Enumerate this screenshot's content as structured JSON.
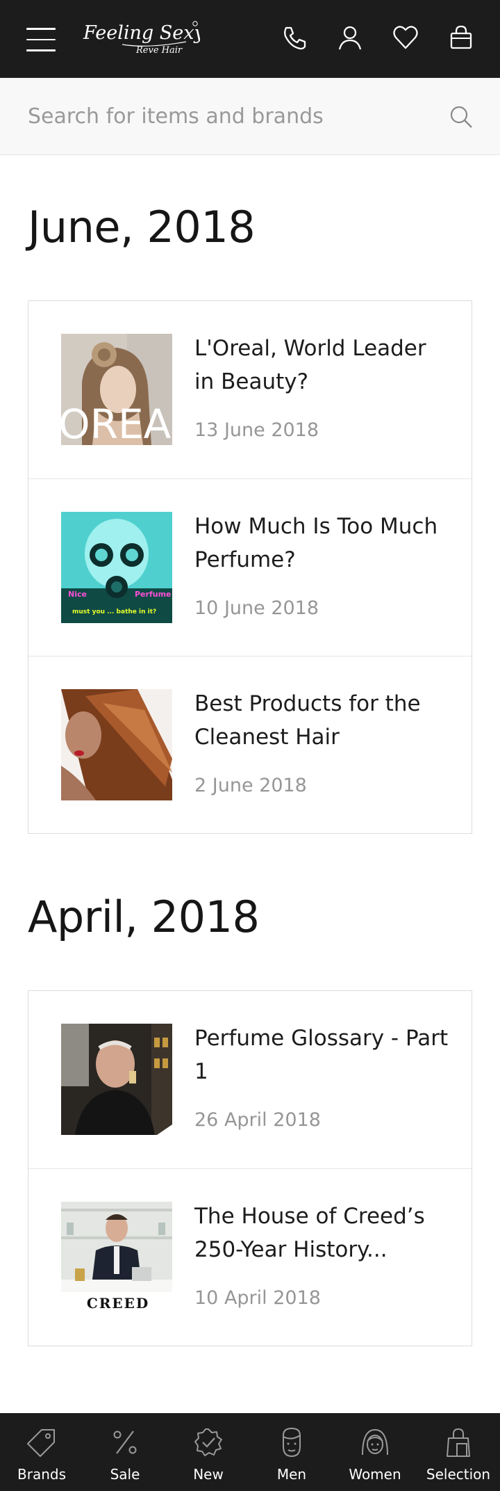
{
  "header": {
    "logo_text": "Feeling Sexy",
    "logo_subtext": "Reve Hair",
    "icons": [
      "menu-icon",
      "phone-icon",
      "user-icon",
      "heart-icon",
      "bag-icon"
    ]
  },
  "search": {
    "placeholder": "Search for items and brands",
    "value": ""
  },
  "sections": [
    {
      "month": "June, 2018",
      "articles": [
        {
          "title": "L'Oreal, World Leader in Beauty?",
          "date": "13 June 2018",
          "image_text": "OREA"
        },
        {
          "title": "How Much Is Too Much Perfume?",
          "date": "10 June 2018",
          "image_text_left": "Nice",
          "image_text_right": "Perfume",
          "image_caption": "must you ... bathe in it?"
        },
        {
          "title": "Best Products for the Cleanest Hair",
          "date": "2 June 2018"
        }
      ]
    },
    {
      "month": "April, 2018",
      "articles": [
        {
          "title": "Perfume Glossary - Part 1",
          "date": "26 April 2018"
        },
        {
          "title": "The House of Creed’s 250-Year History...",
          "date": "10 April 2018",
          "image_text": "CREED"
        }
      ]
    }
  ],
  "bottom_nav": [
    {
      "label": "Brands",
      "icon": "tag-icon"
    },
    {
      "label": "Sale",
      "icon": "percent-icon"
    },
    {
      "label": "New",
      "icon": "badge-check-icon"
    },
    {
      "label": "Men",
      "icon": "man-face-icon"
    },
    {
      "label": "Women",
      "icon": "woman-face-icon"
    },
    {
      "label": "Selection",
      "icon": "shopping-bag-icon"
    }
  ],
  "colors": {
    "bar": "#1c1c1c",
    "search_bg": "#f8f8f8",
    "date": "#969696",
    "border": "#dcdcdc"
  }
}
